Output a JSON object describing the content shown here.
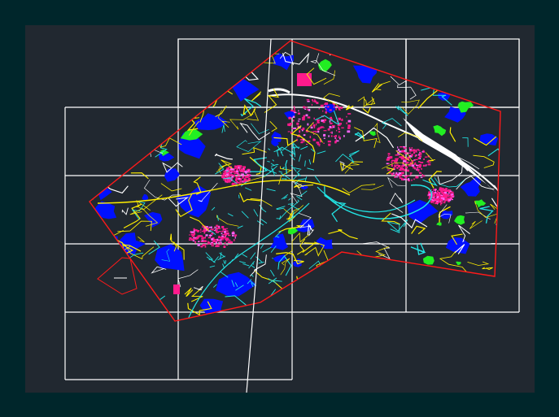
{
  "drawing": {
    "background_color": "#212830",
    "frame_color": "#00262b",
    "layer_colors": {
      "boundary": "#ff1a1a",
      "grid": "#ffffff",
      "vegetation": "#0010ff",
      "parks": "#22ee22",
      "urban": "#ff1a8c",
      "streets_primary": "#ffee00",
      "streets_secondary": "#22e5e5",
      "river": "#ffffff",
      "blocks": "#ff66ff"
    }
  }
}
